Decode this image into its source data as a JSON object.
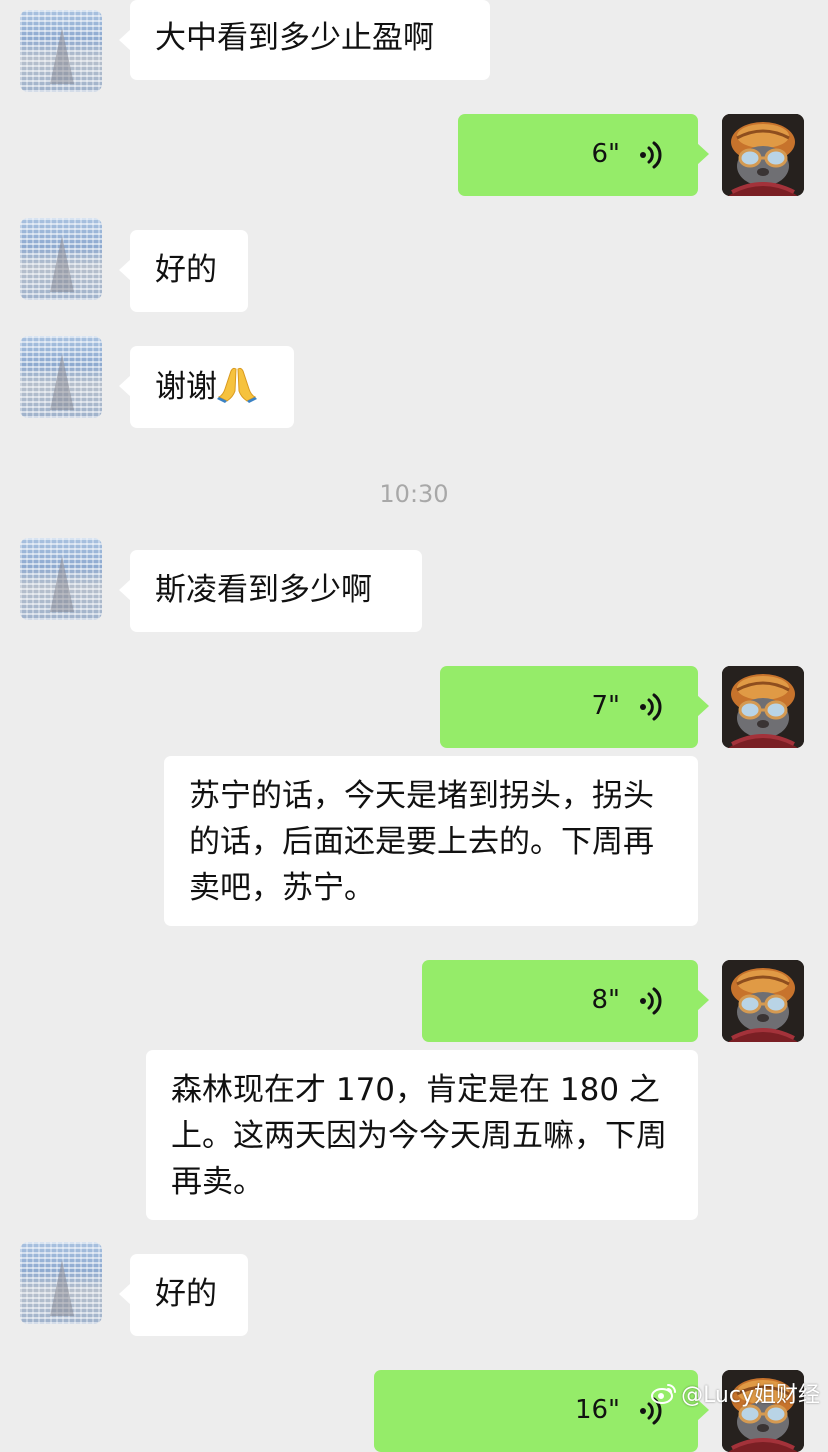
{
  "messages": {
    "m1": {
      "text": "大中看到多少止盈啊"
    },
    "m2": {
      "duration": "6\""
    },
    "m3": {
      "text": "好的"
    },
    "m4": {
      "text": "谢谢",
      "emoji": "folded-hands-emoji"
    },
    "time": "10:30",
    "m5": {
      "text": "斯凌看到多少啊"
    },
    "m6": {
      "duration": "7\"",
      "transcript": "苏宁的话，今天是堵到拐头，拐头的话，后面还是要上去的。下周再卖吧，苏宁。"
    },
    "m7": {
      "duration": "8\"",
      "transcript": "森林现在才 170，肯定是在 180 之上。这两天因为今今天周五嘛，下周再卖。"
    },
    "m8": {
      "text": "好的"
    },
    "m9": {
      "duration": "16\""
    }
  },
  "watermark": {
    "text": "@Lucy姐财经",
    "icon": "weibo-icon"
  },
  "colors": {
    "background": "#ededed",
    "incoming_bubble": "#ffffff",
    "outgoing_bubble": "#95ec69",
    "timestamp": "#a8a8a8"
  }
}
